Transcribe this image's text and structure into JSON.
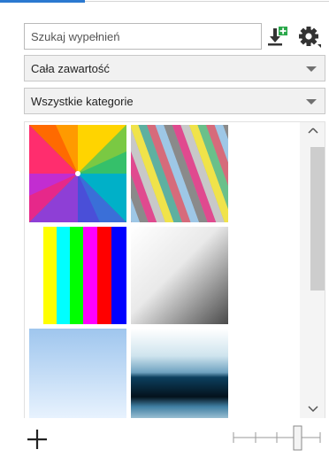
{
  "search": {
    "placeholder": "Szukaj wypełnień",
    "value": ""
  },
  "toolbar": {
    "import_icon": "download-plus-icon",
    "settings_icon": "gear-icon"
  },
  "filters": {
    "content": {
      "selected": "Cała zawartość"
    },
    "category": {
      "selected": "Wszystkie kategorie"
    }
  },
  "gallery": {
    "thumbnails": [
      {
        "id": "radial-multicolor"
      },
      {
        "id": "diagonal-stripes"
      },
      {
        "id": "vertical-color-bars"
      },
      {
        "id": "white-gray-gradient"
      },
      {
        "id": "sky-blue-gradient"
      },
      {
        "id": "blue-horizon-gradient"
      }
    ]
  },
  "bottom": {
    "add_icon": "plus-icon",
    "zoom_slider_icon": "zoom-slider"
  },
  "colors": {
    "accent": "#2b79d0",
    "dropdown_bg": "#f1f1f1",
    "scroll_thumb": "#cdcdcd"
  }
}
